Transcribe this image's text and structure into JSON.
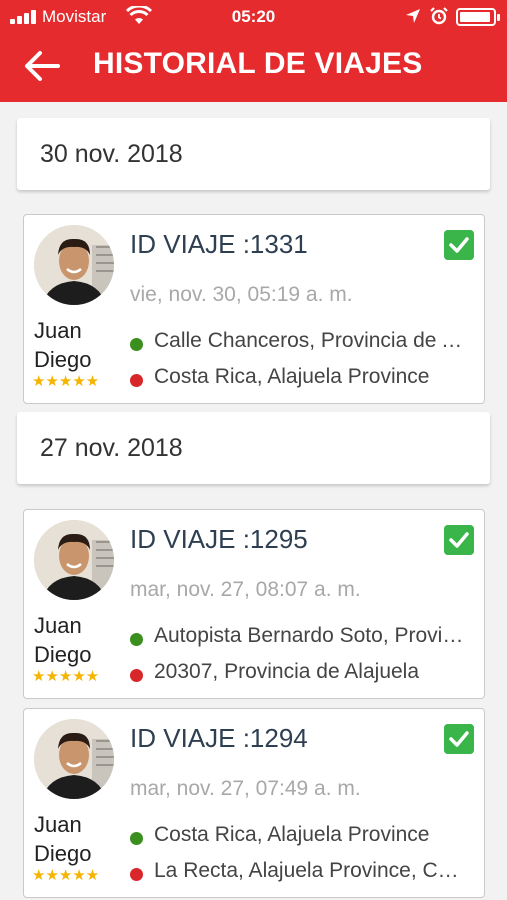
{
  "status_bar": {
    "carrier": "Movistar",
    "time": "05:20"
  },
  "header": {
    "title": "HISTORIAL DE VIAJES"
  },
  "colors": {
    "brand_red": "#e52b2e",
    "origin_dot": "#3a8f1e",
    "destination_dot": "#d9262b",
    "check_green": "#39b54a",
    "star": "#f4b400"
  },
  "groups": [
    {
      "date": "30 nov. 2018",
      "trips": [
        {
          "id_label": "ID VIAJE :1331",
          "datetime": "vie, nov. 30, 05:19 a. m.",
          "driver_first": "Juan",
          "driver_last": "Diego",
          "rating": "★★★★★",
          "origin": "Calle Chanceros, Provincia de Alajuela",
          "destination": "Costa Rica, Alajuela Province"
        }
      ]
    },
    {
      "date": "27 nov. 2018",
      "trips": [
        {
          "id_label": "ID VIAJE :1295",
          "datetime": "mar, nov. 27, 08:07 a. m.",
          "driver_first": "Juan",
          "driver_last": "Diego",
          "rating": "★★★★★",
          "origin": "Autopista Bernardo Soto, Provincia de Alajuela",
          "destination": "20307, Provincia de Alajuela"
        },
        {
          "id_label": "ID VIAJE :1294",
          "datetime": "mar, nov. 27, 07:49 a. m.",
          "driver_first": "Juan",
          "driver_last": "Diego",
          "rating": "★★★★★",
          "origin": "Costa Rica, Alajuela Province",
          "destination": "La Recta, Alajuela Province, Costa Rica"
        }
      ]
    }
  ]
}
